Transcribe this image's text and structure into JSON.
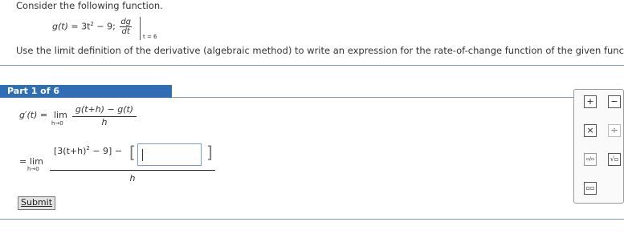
{
  "question": {
    "intro": "Consider the following function.",
    "func_lhs": "g(t)",
    "func_eq": " = 3t",
    "func_exp": "2",
    "func_rest": " − 9;",
    "deriv_num": "dg",
    "deriv_den": "dt",
    "eval_at": "t = 6",
    "instruction": "Use the limit definition of the derivative (algebraic method) to write an expression for the rate-of-change function of the given function."
  },
  "part": {
    "header": "Part 1 of 6"
  },
  "step1": {
    "lhs": "g′(t)",
    "eq": " = ",
    "lim": "lim",
    "lim_sub": "h→0",
    "num": "g(t+h) − g(t)",
    "den": "h"
  },
  "step2": {
    "eq": "= ",
    "lim": "lim",
    "lim_sub": "h→0",
    "num_pre": "[3(t+h)",
    "num_exp": "2",
    "num_post": " − 9] −",
    "bracket_open": "[",
    "bracket_close": "]",
    "den": "h",
    "input_value": ""
  },
  "buttons": {
    "submit": "Submit"
  },
  "palette": {
    "plus": "+",
    "minus": "−",
    "times": "×",
    "divide": "÷",
    "fraction": "▫/▫",
    "sqrt": "√▫",
    "power": "▫▫"
  }
}
